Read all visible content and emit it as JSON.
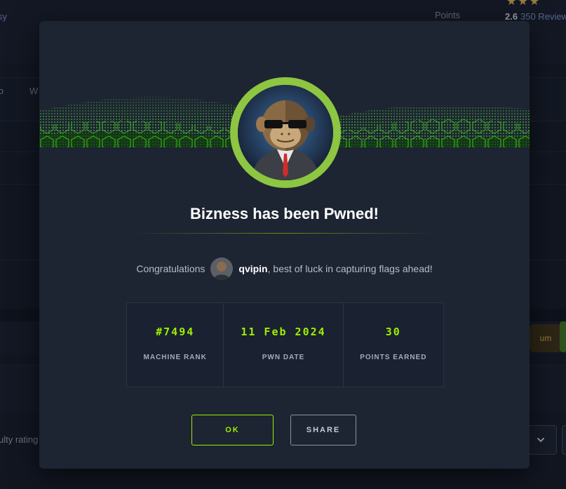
{
  "background": {
    "points_label": "Points",
    "rating_value": "2.6",
    "rating_reviews": "350 Reviews",
    "left_link_fragment": "sy",
    "tab_fragment_1": "fo",
    "tab_fragment_2": "W",
    "chip_fragment": "um",
    "select_placeholder_fragment": "ulty rating"
  },
  "modal": {
    "title": "Bizness has been Pwned!",
    "congrats_prefix": "Congratulations",
    "username": "qvipin",
    "congrats_suffix": ", best of luck in capturing flags ahead!",
    "stats": [
      {
        "value": "#7494",
        "label": "MACHINE RANK"
      },
      {
        "value": "11 Feb 2024",
        "label": "PWN DATE"
      },
      {
        "value": "30",
        "label": "POINTS EARNED"
      }
    ],
    "ok_label": "OK",
    "share_label": "SHARE"
  },
  "colors": {
    "accent": "#9fef00",
    "modal_bg": "#1d2432",
    "page_bg": "#141a26",
    "avatar_ring": "#8dc641"
  },
  "icons": {
    "chevron": "chevron-down-icon",
    "avatar": "machine-avatar-icon",
    "user_avatar": "user-avatar-icon"
  }
}
